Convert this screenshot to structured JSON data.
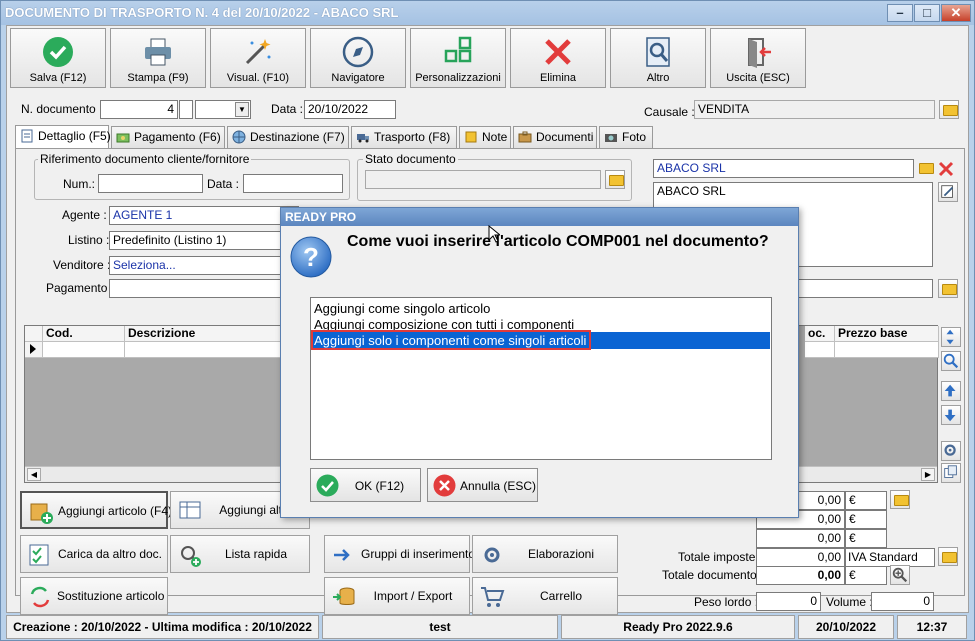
{
  "window": {
    "title": "DOCUMENTO DI TRASPORTO N. 4 del 20/10/2022 - ABACO SRL"
  },
  "toolbar": {
    "buttons": [
      {
        "label": "Salva (F12)"
      },
      {
        "label": "Stampa (F9)"
      },
      {
        "label": "Visual. (F10)"
      },
      {
        "label": "Navigatore"
      },
      {
        "label": "Personalizzazioni"
      },
      {
        "label": "Elimina"
      },
      {
        "label": "Altro"
      },
      {
        "label": "Uscita (ESC)"
      }
    ]
  },
  "header": {
    "ndoc_label": "N. documento :",
    "ndoc_value": "4",
    "data_label": "Data :",
    "data_value": "20/10/2022",
    "causale_label": "Causale :",
    "causale_value": "VENDITA"
  },
  "tabs": [
    {
      "label": "Dettaglio (F5)"
    },
    {
      "label": "Pagamento (F6)"
    },
    {
      "label": "Destinazione (F7)"
    },
    {
      "label": "Trasporto (F8)"
    },
    {
      "label": "Note"
    },
    {
      "label": "Documenti"
    },
    {
      "label": "Foto"
    }
  ],
  "dettaglio": {
    "rif_title": "Riferimento documento cliente/fornitore",
    "num_label": "Num.:",
    "data_label": "Data :",
    "stato_title": "Stato documento",
    "agente_label": "Agente :",
    "agente_value": "AGENTE 1",
    "listino_label": "Listino :",
    "listino_value": "Predefinito (Listino 1)",
    "venditore_label": "Venditore :",
    "venditore_value": "Seleziona...",
    "pagamento_label": "Pagamento :",
    "cliente_name": "ABACO SRL",
    "cliente_address": "ABACO SRL"
  },
  "grid": {
    "columns": [
      "Cod.",
      "Descrizione",
      "oc.",
      "Prezzo base"
    ]
  },
  "actions": {
    "aggiungi_articolo": "Aggiungi articolo (F4)",
    "aggiungi_altro": "Aggiungi altro",
    "carica": "Carica da altro doc.",
    "lista_rapida": "Lista rapida",
    "gruppi": "Gruppi di inserimento",
    "elaborazioni": "Elaborazioni",
    "sostituzione": "Sostituzione articolo",
    "import_export": "Import / Export",
    "carrello": "Carrello"
  },
  "totals": {
    "v1": "0,00",
    "v2": "0,00",
    "v3": "0,00",
    "currency": "€",
    "imposte_label": "Totale imposte :",
    "imposte_value": "0,00",
    "iva": "IVA Standard",
    "documento_label": "Totale documento :",
    "documento_value": "0,00",
    "peso_label": "Peso lordo :",
    "peso_value": "0",
    "volume_label": "Volume :",
    "volume_value": "0"
  },
  "status": {
    "creazione": "Creazione : 20/10/2022 - Ultima modifica : 20/10/2022",
    "user": "test",
    "version": "Ready Pro 2022.9.6",
    "date": "20/10/2022",
    "time": "12:37"
  },
  "dialog": {
    "title": "READY PRO",
    "message": "Come vuoi inserire l'articolo COMP001 nel documento?",
    "options": [
      "Aggiungi come singolo articolo",
      "Aggiungi composizione con tutti i componenti",
      "Aggiungi solo i componenti come singoli articoli"
    ],
    "ok_label": "OK (F12)",
    "cancel_label": "Annulla (ESC)"
  },
  "colors": {
    "selection": "#0a64d3",
    "highlight": "#e03a3a",
    "title_bar": "#a5c2e3"
  }
}
